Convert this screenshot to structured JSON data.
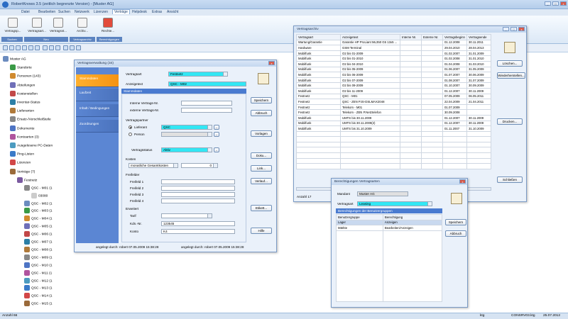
{
  "app": {
    "title": "RobertKnows 3.5 (zeitlich begrenzte Version) - [Muster AG]"
  },
  "menu": [
    "Datei",
    "Bearbeiten",
    "Suchen",
    "Netzwerk",
    "Lizenzen",
    "Verträge",
    "Helpdesk",
    "Extras",
    "Ansicht"
  ],
  "ribbon": {
    "buttons": [
      "Vertragsp...",
      "Vertragsart...",
      "Vertragsst...",
      "Archiv...",
      "Rechte..."
    ],
    "groups": [
      "Suchen",
      "Neu",
      "Vertragsarchiv",
      "Berechtigungen"
    ]
  },
  "tree": [
    {
      "label": "Muster AG",
      "level": 0
    },
    {
      "label": "Standorte",
      "level": 1
    },
    {
      "label": "Personen (143)",
      "level": 1
    },
    {
      "label": "Abteilungen",
      "level": 1
    },
    {
      "label": "Kostenstellen",
      "level": 1
    },
    {
      "label": "Inventar-Status",
      "level": 1
    },
    {
      "label": "Lieferanten",
      "level": 1
    },
    {
      "label": "Ersatz-/Verschleißteile",
      "level": 1
    },
    {
      "label": "Dokumente",
      "level": 1
    },
    {
      "label": "Kontoarten (3)",
      "level": 1
    },
    {
      "label": "Ausgelesene PC-Daten",
      "level": 1
    },
    {
      "label": "Ping-Listen",
      "level": 1
    },
    {
      "label": "Lizenzen",
      "level": 1
    },
    {
      "label": "Verträge (7)",
      "level": 1
    },
    {
      "label": "Festnetz",
      "level": 2
    },
    {
      "label": "QSC - M01 (1",
      "level": 3
    },
    {
      "label": "03080",
      "level": 4
    },
    {
      "label": "QSC - M02 (1",
      "level": 3
    },
    {
      "label": "QSC - M03 (1",
      "level": 3
    },
    {
      "label": "QSC - M04 (1",
      "level": 3
    },
    {
      "label": "QSC - M05 (1",
      "level": 3
    },
    {
      "label": "QSC - M06 (1",
      "level": 3
    },
    {
      "label": "QSC - M07 (1",
      "level": 3
    },
    {
      "label": "QSC - M08 (1",
      "level": 3
    },
    {
      "label": "QSC - M09 (1",
      "level": 3
    },
    {
      "label": "QSC - M10 (1",
      "level": 3
    },
    {
      "label": "QSC - M11 (1",
      "level": 3
    },
    {
      "label": "QSC - M12 (1",
      "level": 3
    },
    {
      "label": "QSC - M13 (1",
      "level": 3
    },
    {
      "label": "QSC - M14 (1",
      "level": 3
    },
    {
      "label": "QSC - M15 (1",
      "level": 3
    }
  ],
  "status": {
    "left": "Anzahl 66",
    "mid": "ktg",
    "right": "CONSRV03.ktg",
    "date": "25.07.2012"
  },
  "vv": {
    "title": "Vertragsverwaltung (34)",
    "tabs": [
      "Stammdaten",
      "Laufzeit",
      "Inhalt / Bedingungen",
      "Zuordnungen"
    ],
    "vertragsart_label": "Vertragsart",
    "vertragsart": "Festnetz",
    "anzeigetext_label": "Anzeigetext",
    "anzeigetext": "QSC - M02",
    "section_stammdaten": "Stammdaten",
    "interne_label": "Interne Vertrags-Nr.",
    "externe_label": "externe Vertrags-Nr.",
    "partner_label": "Vertragspartner",
    "lieferant_label": "Lieferant",
    "lieferant": "QSC",
    "person_label": "Person",
    "status_label": "Vertragsstatus",
    "status": "Aktiv",
    "kosten_label": "Kosten",
    "kosten": "monatliche Gesamtkosten",
    "kosten_value": "0",
    "freifelder_label": "Freifelder",
    "freifelder": [
      "Freifeld 1",
      "Freifeld 2",
      "Freifeld 3",
      "Freifeld 4"
    ],
    "erweitert_label": "Erweitert",
    "tarif_label": "Tarif",
    "kdnr_label": "Kdn.-Nr.",
    "kdnr": "123545",
    "konto_label": "Konto",
    "konto": "K4",
    "buttons": [
      "Speichern",
      "Abbruch",
      "Vorlagen",
      "Doku...",
      "Link...",
      "Verlauf...",
      "Etikett...",
      "Hilfe"
    ],
    "footer_left": "angelegt durch: robert 07.05.2009 15:38:28",
    "footer_right": "angelegt durch: robert 07.05.2009 15:38:28"
  },
  "archiv": {
    "title": "Vertragsarchiv",
    "columns": [
      "Vertragsart",
      "Anzeigetext",
      "Interne Nr.",
      "Externe Nr.",
      "Vertragsbeginn",
      "Vertragsende"
    ],
    "rows": [
      [
        "Wartung/Garantie",
        "Garantie HP ProLiant ML350 G5 13x5 ...",
        "",
        "",
        "01.12.2008",
        "30.11.2011"
      ],
      [
        "Hardware",
        "GSM Terminal",
        "",
        "",
        "29.04.2010",
        "28.04.2013"
      ],
      [
        "Mobilfunk",
        "O2 bis 01-2009",
        "",
        "",
        "01.02.2007",
        "31.01.2009"
      ],
      [
        "Mobilfunk",
        "O2 bis 01-2010",
        "",
        "",
        "01.02.2008",
        "31.01.2010"
      ],
      [
        "Mobilfunk",
        "O2 bis 04-2010",
        "",
        "",
        "01.04.2008",
        "31.03.2010"
      ],
      [
        "Mobilfunk",
        "O2 bis 05-2009",
        "",
        "",
        "01.06.2007",
        "31.05.2009"
      ],
      [
        "Mobilfunk",
        "O2 bis 06-2009",
        "",
        "",
        "01.07.2007",
        "30.06.2009"
      ],
      [
        "Mobilfunk",
        "O2 bis 07-2009",
        "",
        "",
        "01.08.2007",
        "31.07.2009"
      ],
      [
        "Mobilfunk",
        "O2 bis 09-2009",
        "",
        "",
        "01.10.2007",
        "30.09.2009"
      ],
      [
        "Mobilfunk",
        "O2 bis 11-2009",
        "",
        "",
        "01.12.2007",
        "30.11.2009"
      ],
      [
        "Festnetz",
        "QSC - M01",
        "",
        "",
        "07.05.2009",
        "06.05.2011"
      ],
      [
        "Festnetz",
        "QSC - ZEN PJS-DSLMAX2048",
        "",
        "",
        "22.04.2009",
        "21.04.2011"
      ],
      [
        "Festnetz",
        "Telekom - M01",
        "",
        "",
        "01.07.2009",
        ""
      ],
      [
        "Festnetz",
        "Telekom - ZEN P.Netztelefon",
        "",
        "",
        "30.09.2008",
        ""
      ],
      [
        "Mobilfunk",
        "UMTS bis 30.11.2009",
        "",
        "",
        "01.12.2007",
        "30.11.2009"
      ],
      [
        "Mobilfunk",
        "UMTS bis 30.11.2009(2)",
        "",
        "",
        "01.12.2007",
        "30.11.2009"
      ],
      [
        "Mobilfunk",
        "UMTS bis 31.10.2009",
        "",
        "",
        "01.11.2007",
        "31.10.2009"
      ]
    ],
    "buttons": [
      "Löschen...",
      "Wiederherstellen...",
      "Drucken...",
      "Schließen"
    ],
    "count": "Anzahl 17"
  },
  "berecht": {
    "title": "Berechtigungen Vertragsarten",
    "mandant_label": "Mandant",
    "mandant": "Muster AG",
    "vertragsart_label": "Vertragsart",
    "vertragsart": "Leasing",
    "section": "Berechtigungen der Benutzergruppen",
    "columns": [
      "Benutzergruppe",
      "Berechtigung"
    ],
    "rows": [
      [
        "Lager",
        "Anzeigen"
      ],
      [
        "Märkte",
        "Bearbeiten/Anzeigen"
      ]
    ],
    "buttons": [
      "Speichern",
      "Abbruch"
    ]
  }
}
